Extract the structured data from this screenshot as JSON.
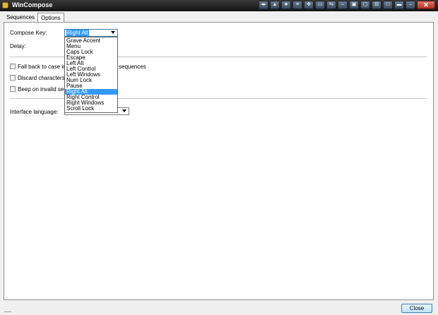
{
  "window": {
    "title": "WinCompose",
    "title_buttons": [
      "◂▸",
      "▲",
      "★",
      "≡",
      "✜",
      "▭",
      "⇆",
      "⇔",
      "▣",
      "▢",
      "⊟",
      "□",
      "▬",
      "–",
      "▫"
    ],
    "close_label": "✕"
  },
  "tabs": [
    {
      "label": "Sequences",
      "active": false
    },
    {
      "label": "Options",
      "active": true
    }
  ],
  "options": {
    "compose_key_label": "Compose Key:",
    "compose_key_value": "Right Alt",
    "delay_label": "Delay:",
    "fallback_label": "Fall back to case insens",
    "fallback_suffix": "sequences",
    "discard_label": "Discard characters from",
    "beep_label": "Beep on invalid sequen",
    "language_label": "Interface language:",
    "language_value": "Autodetect"
  },
  "compose_dropdown": {
    "items": [
      "Grave Accent `",
      "Menu",
      "Caps Lock",
      "Escape",
      "Left Alt",
      "Left Control",
      "Left Windows",
      "Num Lock",
      "Pause",
      "Right Alt",
      "Right Control",
      "Right Windows",
      "Scroll Lock"
    ],
    "selected": "Right Alt"
  },
  "footer": {
    "close_button": "Close"
  },
  "colors": {
    "selection": "#3399ff",
    "titlebar": "#1e1e1e"
  }
}
